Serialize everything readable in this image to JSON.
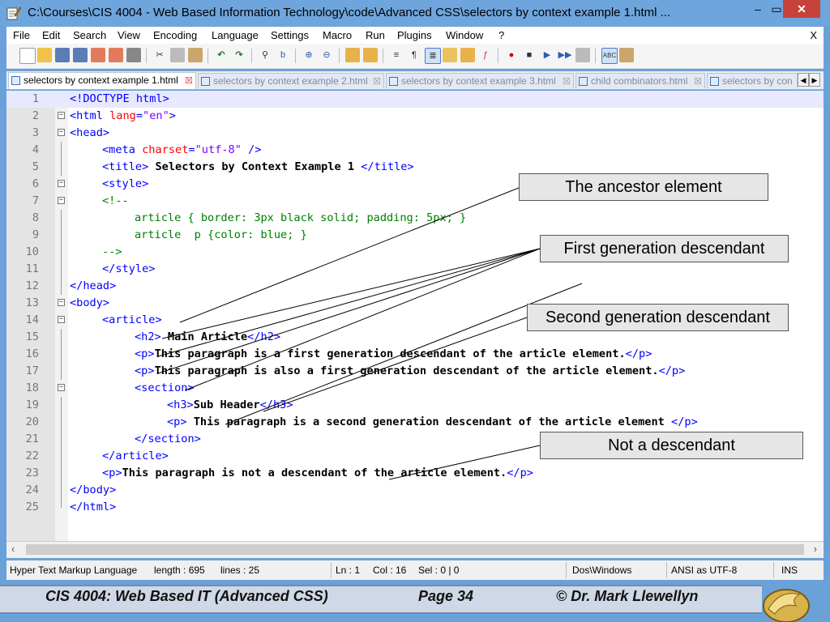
{
  "window": {
    "title": "C:\\Courses\\CIS 4004 - Web Based Information Technology\\code\\Advanced CSS\\selectors by context example 1.html ...",
    "minimize": "–",
    "maximize": "▭",
    "close": "✕"
  },
  "menu": {
    "items": [
      "File",
      "Edit",
      "Search",
      "View",
      "Encoding",
      "Language",
      "Settings",
      "Macro",
      "Run",
      "Plugins",
      "Window",
      "?"
    ],
    "close_doc": "X"
  },
  "tabs": [
    {
      "label": "selectors by context example 1.html"
    },
    {
      "label": "selectors by context example 2.html"
    },
    {
      "label": "selectors by context example 3.html"
    },
    {
      "label": "child combinators.html"
    },
    {
      "label": "selectors by con"
    }
  ],
  "code_lines": [
    {
      "n": "1"
    },
    {
      "n": "2"
    },
    {
      "n": "3"
    },
    {
      "n": "4"
    },
    {
      "n": "5"
    },
    {
      "n": "6"
    },
    {
      "n": "7"
    },
    {
      "n": "8"
    },
    {
      "n": "9"
    },
    {
      "n": "10"
    },
    {
      "n": "11"
    },
    {
      "n": "12"
    },
    {
      "n": "13"
    },
    {
      "n": "14"
    },
    {
      "n": "15"
    },
    {
      "n": "16"
    },
    {
      "n": "17"
    },
    {
      "n": "18"
    },
    {
      "n": "19"
    },
    {
      "n": "20"
    },
    {
      "n": "21"
    },
    {
      "n": "22"
    },
    {
      "n": "23"
    },
    {
      "n": "24"
    },
    {
      "n": "25"
    }
  ],
  "code": {
    "l1": "<!DOCTYPE html>",
    "l2_open": "<html ",
    "l2_attr": "lang",
    "l2_eq": "=",
    "l2_val": "\"en\"",
    "l2_close": ">",
    "l3": "<head>",
    "l4_open": "<meta ",
    "l4_attr": "charset",
    "l4_eq": "=",
    "l4_val": "\"utf-8\"",
    "l4_close": " />",
    "l5_open": "<title>",
    "l5_text": " Selectors by Context Example 1 ",
    "l5_close": "</title>",
    "l6": "<style>",
    "l7": "<!--",
    "l8": "article { border: 3px black solid; padding: 5px; }",
    "l9": "article  p {color: blue; }",
    "l10": "-->",
    "l11": "</style>",
    "l12": "</head>",
    "l13": "<body>",
    "l14": "<article>",
    "l15_open": "<h2>",
    "l15_text": " Main Article",
    "l15_close": "</h2>",
    "l16_open": "<p>",
    "l16_text": "This paragraph is a first generation descendant of the article element.",
    "l16_close": "</p>",
    "l17_open": "<p>",
    "l17_text": "This paragraph is also a first generation descendant of the article element.",
    "l17_close": "</p>",
    "l18": "<section>",
    "l19_open": "<h3>",
    "l19_text": "Sub Header",
    "l19_close": "</h3>",
    "l20_open": "<p>",
    "l20_text": " This paragraph is a second generation descendant of the article element ",
    "l20_close": "</p>",
    "l21": "</section>",
    "l22": "</article>",
    "l23_open": "<p>",
    "l23_text": "This paragraph is not a descendant of the article element.",
    "l23_close": "</p>",
    "l24": "</body>",
    "l25": "</html>"
  },
  "callouts": {
    "ancestor": "The ancestor element",
    "first_gen": "First generation descendant",
    "second_gen": "Second generation descendant",
    "not_desc": "Not a descendant"
  },
  "status": {
    "language": "Hyper Text Markup Language",
    "length": "length : 695",
    "lines": "lines : 25",
    "ln": "Ln : 1",
    "col": "Col : 16",
    "sel": "Sel : 0 | 0",
    "eol": "Dos\\Windows",
    "encoding": "ANSI as UTF-8",
    "mode": "INS"
  },
  "footer": {
    "course": "CIS 4004: Web Based IT (Advanced CSS)",
    "page": "Page 34",
    "author": "© Dr. Mark Llewellyn"
  },
  "colors": {
    "tag": "#0000ff",
    "attr": "#ff0000",
    "value": "#8000ff",
    "comment": "#008000",
    "titlebar": "#6ea5dd",
    "close": "#c7423a"
  }
}
